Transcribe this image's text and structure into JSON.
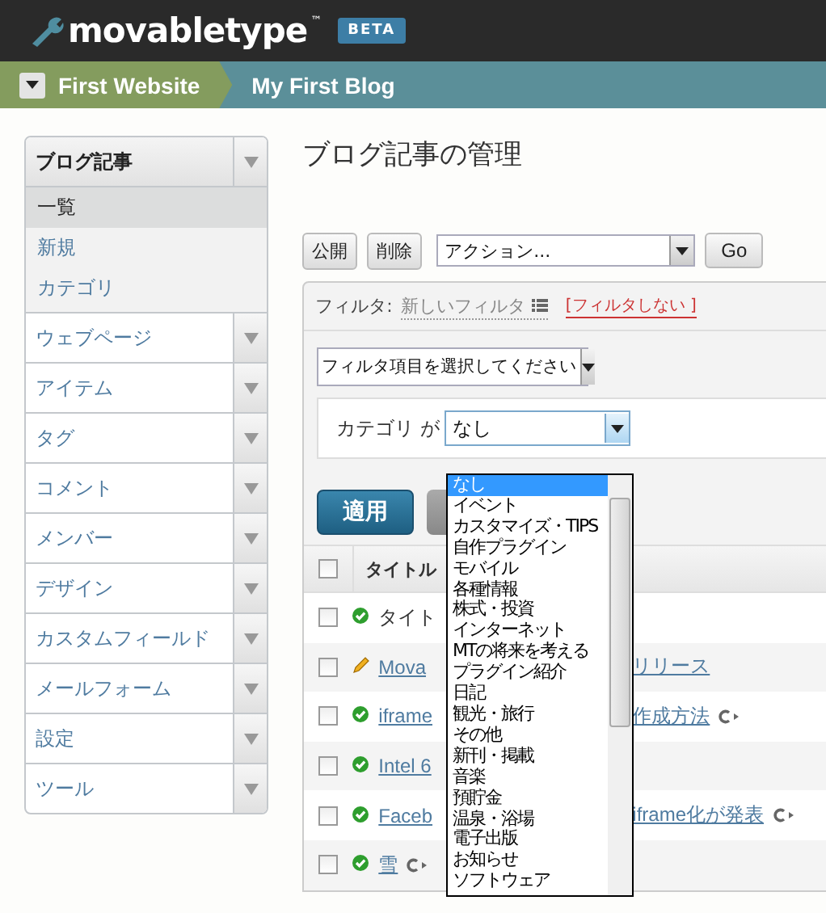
{
  "header": {
    "logo": "movabletype",
    "trademark": "™",
    "badge": "BETA"
  },
  "breadcrumb": [
    {
      "label": "First Website",
      "kind": "website"
    },
    {
      "label": "My First Blog",
      "kind": "blog"
    }
  ],
  "sidebar": {
    "items": [
      {
        "label": "ブログ記事",
        "expanded": true,
        "children": [
          {
            "label": "一覧",
            "selected": true
          },
          {
            "label": "新規",
            "selected": false
          },
          {
            "label": "カテゴリ",
            "selected": false
          }
        ]
      },
      {
        "label": "ウェブページ",
        "expanded": false
      },
      {
        "label": "アイテム",
        "expanded": false
      },
      {
        "label": "タグ",
        "expanded": false
      },
      {
        "label": "コメント",
        "expanded": false
      },
      {
        "label": "メンバー",
        "expanded": false
      },
      {
        "label": "デザイン",
        "expanded": false
      },
      {
        "label": "カスタムフィールド",
        "expanded": false
      },
      {
        "label": "メールフォーム",
        "expanded": false
      },
      {
        "label": "設定",
        "expanded": false
      },
      {
        "label": "ツール",
        "expanded": false
      }
    ]
  },
  "page_title": "ブログ記事の管理",
  "actions": {
    "buttons": [
      "公開",
      "削除"
    ],
    "action_select": "アクション...",
    "go": "Go"
  },
  "filter": {
    "label": "フィルタ:",
    "name": "新しいフィルタ",
    "clear": "[フィルタしない ]",
    "item_select": "フィルタ項目を選択してください",
    "condition_label": "カテゴリ が",
    "condition_value": "なし",
    "apply": "適用"
  },
  "dropdown": {
    "options": [
      {
        "label": "なし",
        "selected": true
      },
      {
        "label": "イベント",
        "selected": false
      },
      {
        "label": "カスタマイズ・TIPS",
        "selected": false
      },
      {
        "label": "自作プラグイン",
        "selected": false
      },
      {
        "label": "モバイル",
        "selected": false
      },
      {
        "label": "各種情報",
        "selected": false
      },
      {
        "label": "株式・投資",
        "selected": false
      },
      {
        "label": "インターネット",
        "selected": false
      },
      {
        "label": "MTの将来を考える",
        "selected": false
      },
      {
        "label": "プラグイン紹介",
        "selected": false
      },
      {
        "label": "日記",
        "selected": false
      },
      {
        "label": "観光・旅行",
        "selected": false
      },
      {
        "label": "その他",
        "selected": false
      },
      {
        "label": "新刊・掲載",
        "selected": false
      },
      {
        "label": "音楽",
        "selected": false
      },
      {
        "label": "預貯金",
        "selected": false
      },
      {
        "label": "温泉・浴場",
        "selected": false
      },
      {
        "label": "電子出版",
        "selected": false
      },
      {
        "label": "お知らせ",
        "selected": false
      },
      {
        "label": "ソフトウェア",
        "selected": false
      }
    ]
  },
  "table": {
    "header_checked": false,
    "columns": [
      "タイトル"
    ],
    "rows": [
      {
        "checked": false,
        "kind": "published",
        "title": "タイト",
        "reblog": false
      },
      {
        "checked": false,
        "kind": "draft",
        "title": "Mova",
        "title_tail": "リリース",
        "reblog": false
      },
      {
        "checked": false,
        "kind": "published",
        "title": "iframe",
        "title_tail": "作成方法",
        "reblog": true
      },
      {
        "checked": false,
        "kind": "published",
        "title": "Intel 6",
        "reblog": false
      },
      {
        "checked": false,
        "kind": "published",
        "title": "Faceb",
        "title_tail": "iframe化が発表",
        "reblog": true
      },
      {
        "checked": false,
        "kind": "published",
        "title": "雪",
        "reblog": true
      }
    ]
  }
}
